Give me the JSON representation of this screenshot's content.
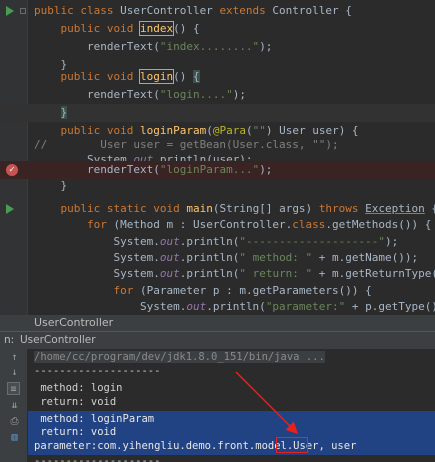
{
  "editor": {
    "lines": [
      {
        "pre": "public class UserController extends Controller {"
      },
      {
        "pre": "    public void index() {"
      },
      {
        "pre": "        renderText(\"index........\");"
      },
      {
        "pre": "    }"
      },
      {
        "pre": ""
      },
      {
        "pre": "    public void login() {"
      },
      {
        "pre": "        renderText(\"login....\");"
      },
      {
        "pre": "    }"
      },
      {
        "pre": ""
      },
      {
        "pre": "    public void loginParam(@Para(\"\") User user) {"
      },
      {
        "pre": "//        User user = getBean(User.class, \"\");"
      },
      {
        "pre": "        System.out.println(user);"
      },
      {
        "pre": "        renderText(\"loginParam...\");"
      },
      {
        "pre": "    }"
      },
      {
        "pre": ""
      },
      {
        "pre": "    public static void main(String[] args) throws Exception {"
      },
      {
        "pre": "        for (Method m : UserController.class.getMethods()) {"
      },
      {
        "pre": "            System.out.println(\"--------------------\");"
      },
      {
        "pre": "            System.out.println(\" method: \" + m.getName());"
      },
      {
        "pre": "            System.out.println(\" return: \" + m.getReturnType().getName());"
      },
      {
        "pre": "            for (Parameter p : m.getParameters()) {"
      },
      {
        "pre": "                System.out.println(\"parameter:\" + p.getType().getName() + \","
      },
      {
        "pre": "            }"
      },
      {
        "pre": "        }"
      }
    ]
  },
  "split_label": "UserController",
  "run_window": {
    "header_prefix": "n:",
    "tab_label": "UserController",
    "toolbar_icons": [
      "up-arrow-icon",
      "down-arrow-icon",
      "soft-wrap-icon",
      "scroll-to-end-icon",
      "print-icon",
      "trash-icon"
    ],
    "console_lines": [
      "/home/cc/program/dev/jdk1.8.0_151/bin/java ...",
      "--------------------",
      " method: login",
      " return: void",
      "--------------------",
      " method: loginParam",
      " return: void",
      "parameter:com.yihengliu.demo.front.model.User, user",
      "--------------------"
    ]
  },
  "colors": {
    "keyword": "#cc7832",
    "method": "#ffc66d",
    "string": "#6a8759",
    "annotation": "#bbb529",
    "static_field": "#9876aa",
    "selection": "#214283",
    "highlight_red": "#e8211d"
  }
}
